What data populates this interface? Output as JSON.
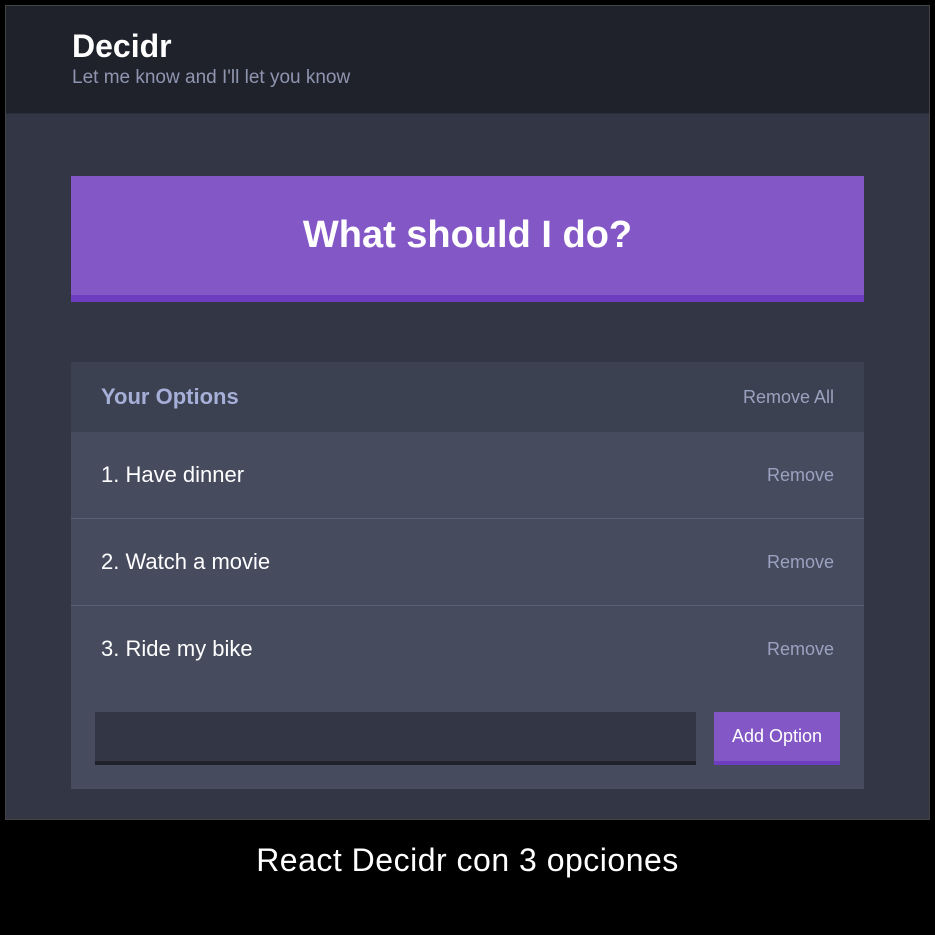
{
  "header": {
    "title": "Decidr",
    "subtitle": "Let me know and I'll let you know"
  },
  "action": {
    "decide_label": "What should I do?"
  },
  "options_panel": {
    "title": "Your Options",
    "remove_all_label": "Remove All",
    "remove_label": "Remove",
    "items": [
      {
        "index": "1.",
        "text": "Have dinner"
      },
      {
        "index": "2.",
        "text": "Watch a movie"
      },
      {
        "index": "3.",
        "text": "Ride my bike"
      }
    ]
  },
  "add_form": {
    "input_value": "",
    "button_label": "Add Option"
  },
  "caption": "React Decidr con 3 opciones"
}
